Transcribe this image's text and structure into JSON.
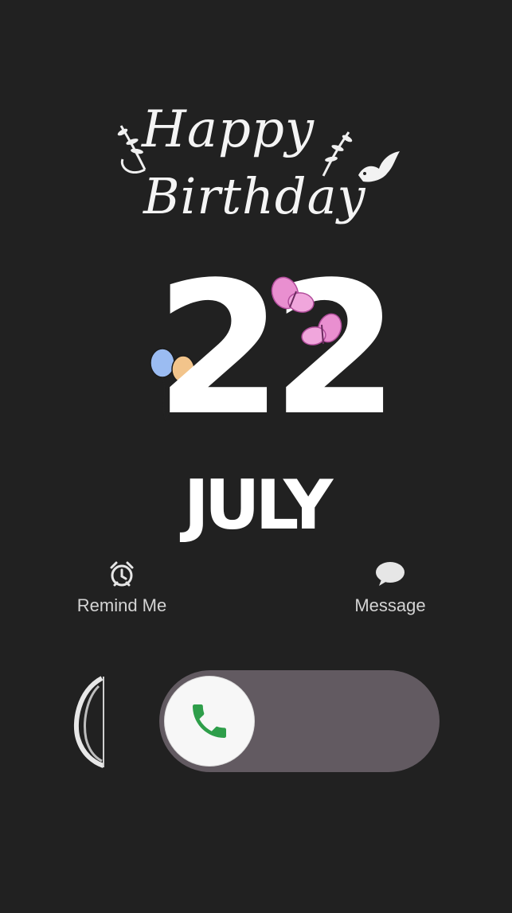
{
  "greeting": {
    "line1": "Happy",
    "line2": "Birthday"
  },
  "date": {
    "day": "22",
    "month": "JULY"
  },
  "actions": {
    "remind": {
      "label": "Remind Me",
      "icon": "alarm-clock-icon"
    },
    "message": {
      "label": "Message",
      "icon": "speech-bubble-icon"
    }
  },
  "slider": {
    "icon": "phone-icon",
    "accent": "#2e9e4a",
    "track_color": "#625a61"
  },
  "decorations": {
    "balloons": [
      "#9bbcf2",
      "#f2c48b"
    ],
    "butterfly_color": "#e98fd0"
  }
}
